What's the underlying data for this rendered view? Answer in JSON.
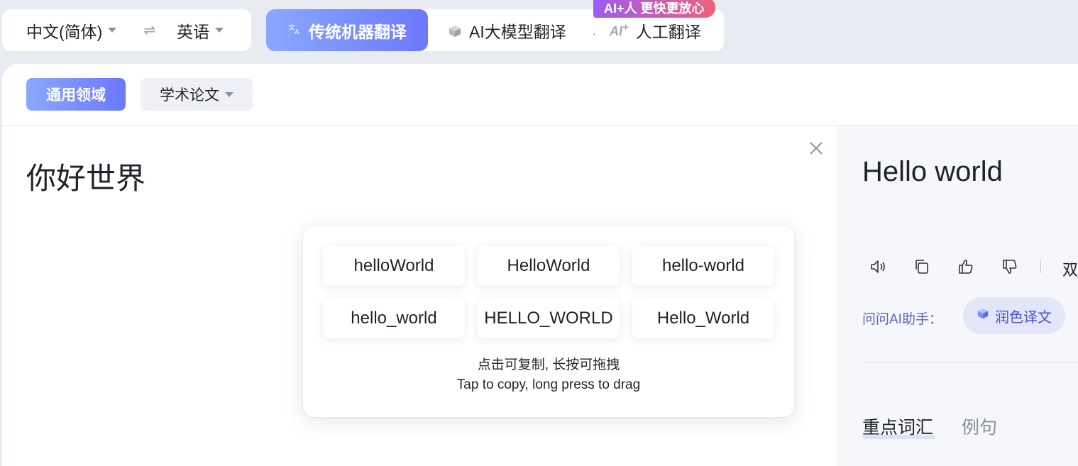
{
  "language_bar": {
    "source_lang": "中文(简体)",
    "swap_symbol": "⇌",
    "target_lang": "英语"
  },
  "modes": {
    "traditional": "传统机器翻译",
    "ai_model": "AI大模型翻译",
    "separator": "·",
    "human": "人工翻译",
    "promo_badge": "AI+人 更快更放心",
    "ai_icon_text": "AI"
  },
  "domains": {
    "general": "通用领域",
    "academic": "学术论文"
  },
  "source": {
    "text": "你好世界"
  },
  "result": {
    "text": "Hello world",
    "bilingual_partial": "双",
    "ask_ai_label": "问问AI助手：",
    "polish_label": "润色译文",
    "tab_vocab": "重点词汇",
    "tab_examples": "例句"
  },
  "popup": {
    "variants": [
      "helloWorld",
      "HelloWorld",
      "hello-world",
      "hello_world",
      "HELLO_WORLD",
      "Hello_World"
    ],
    "hint_zh": "点击可复制, 长按可拖拽",
    "hint_en": "Tap to copy, long press to drag"
  },
  "colors": {
    "accent_gradient_start": "#8aa8ff",
    "accent_gradient_end": "#6b78fb",
    "badge_gradient_start": "#9b5cf6",
    "badge_gradient_end": "#f0607a",
    "ai_label": "#5b63c9"
  }
}
